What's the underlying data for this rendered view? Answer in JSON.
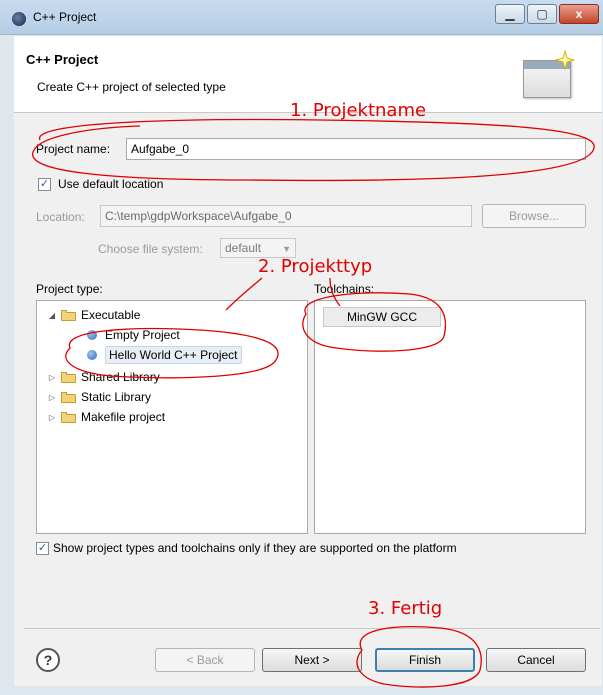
{
  "window": {
    "title": "C++ Project",
    "minimize": "▁",
    "maximize": "▢",
    "close": "x"
  },
  "header": {
    "title": "C++ Project",
    "description": "Create C++ project of selected type"
  },
  "project_name": {
    "label": "Project name:",
    "value": "Aufgabe_0"
  },
  "default_location": {
    "label": "Use default location",
    "checked": true
  },
  "location": {
    "label": "Location:",
    "value": "C:\\temp\\gdpWorkspace\\Aufgabe_0",
    "browse": "Browse..."
  },
  "file_system": {
    "label": "Choose file system:",
    "value": "default"
  },
  "project_type": {
    "label": "Project type:",
    "items": [
      {
        "label": "Executable",
        "expanded": true
      },
      {
        "label": "Empty Project"
      },
      {
        "label": "Hello World C++ Project",
        "selected": true
      },
      {
        "label": "Shared Library",
        "expanded": false
      },
      {
        "label": "Static Library",
        "expanded": false
      },
      {
        "label": "Makefile project",
        "expanded": false
      }
    ]
  },
  "toolchains": {
    "label": "Toolchains:",
    "items": [
      "MinGW GCC"
    ]
  },
  "filter": {
    "label": "Show project types and toolchains only if they are supported on the platform",
    "checked": true
  },
  "buttons": {
    "help": "?",
    "back": "< Back",
    "next": "Next >",
    "finish": "Finish",
    "cancel": "Cancel"
  },
  "annotations": {
    "a1": "1. Projektname",
    "a2": "2. Projekttyp",
    "a3": "3. Fertig",
    "color": "#e00000"
  },
  "icons": [
    "eclipse-icon",
    "wizard-banner-icon",
    "folder-icon",
    "bullet-icon",
    "help-icon"
  ]
}
